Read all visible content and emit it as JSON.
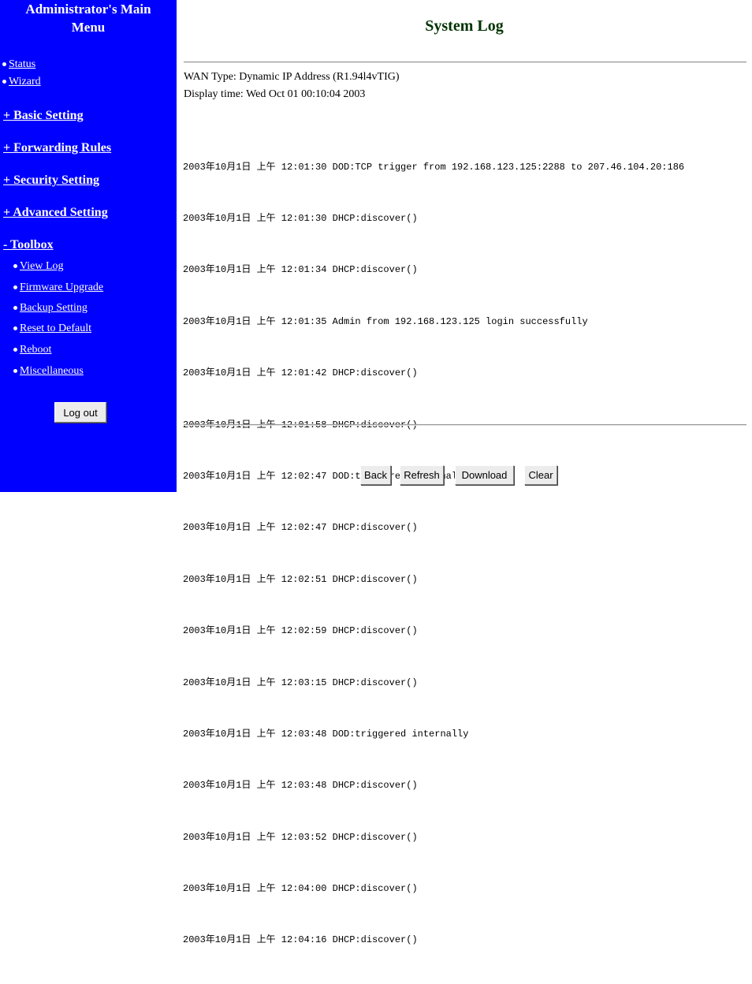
{
  "sidebar": {
    "title_line1": "Administrator's Main",
    "title_line2": "Menu",
    "top_items": [
      "Status",
      "Wizard"
    ],
    "sections": [
      "+ Basic Setting",
      "+ Forwarding Rules",
      "+ Security Setting",
      "+ Advanced Setting",
      "- Toolbox"
    ],
    "toolbox_items": [
      "View Log",
      "Firmware Upgrade",
      "Backup Setting",
      "Reset to Default",
      "Reboot",
      "Miscellaneous"
    ],
    "logout_label": "Log out"
  },
  "main": {
    "title": "System Log",
    "wan_type": "WAN Type: Dynamic IP Address (R1.94l4vTIG)",
    "display_time": "Display time: Wed Oct 01 00:10:04 2003",
    "log_lines": [
      "2003年10月1日 上午 12:01:30 DOD:TCP trigger from 192.168.123.125:2288 to 207.46.104.20:186",
      "2003年10月1日 上午 12:01:30 DHCP:discover()",
      "2003年10月1日 上午 12:01:34 DHCP:discover()",
      "2003年10月1日 上午 12:01:35 Admin from 192.168.123.125 login successfully",
      "2003年10月1日 上午 12:01:42 DHCP:discover()",
      "2003年10月1日 上午 12:01:58 DHCP:discover()",
      "2003年10月1日 上午 12:02:47 DOD:triggered internally",
      "2003年10月1日 上午 12:02:47 DHCP:discover()",
      "2003年10月1日 上午 12:02:51 DHCP:discover()",
      "2003年10月1日 上午 12:02:59 DHCP:discover()",
      "2003年10月1日 上午 12:03:15 DHCP:discover()",
      "2003年10月1日 上午 12:03:48 DOD:triggered internally",
      "2003年10月1日 上午 12:03:48 DHCP:discover()",
      "2003年10月1日 上午 12:03:52 DHCP:discover()",
      "2003年10月1日 上午 12:04:00 DHCP:discover()",
      "2003年10月1日 上午 12:04:16 DHCP:discover()"
    ],
    "buttons": {
      "back": "Back",
      "refresh": "Refresh",
      "download": "Download",
      "clear": "Clear"
    }
  }
}
